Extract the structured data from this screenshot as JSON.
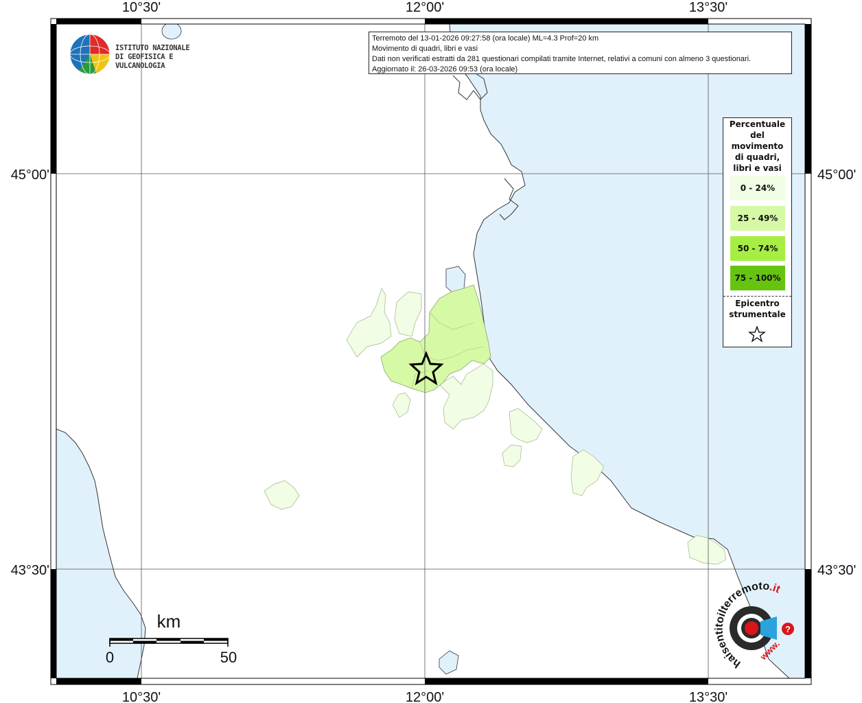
{
  "info": {
    "line1": "Terremoto del 13-01-2026 09:27:58 (ora locale) ML=4.3 Prof=20 km",
    "line2": "Movimento di quadri, libri e vasi",
    "line3": "Dati non verificati estratti da 281 questionari compilati tramite Internet, relativi a comuni con almeno 3 questionari.",
    "line4": "Aggiornato il: 26-03-2026 09:53 (ora locale)"
  },
  "logo": {
    "line1": "ISTITUTO NAZIONALE",
    "line2": "DI GEOFISICA E VULCANOLOGIA"
  },
  "axes": {
    "lon_labels": [
      "10°30'",
      "12°00'",
      "13°30'"
    ],
    "lat_labels": [
      "45°00'",
      "43°30'"
    ]
  },
  "scale_bar": {
    "unit": "km",
    "min_label": "0",
    "max_label": "50"
  },
  "legend": {
    "title_lines": [
      "Percentuale",
      "del",
      "movimento",
      "di quadri,",
      "libri e vasi"
    ],
    "items": [
      {
        "label": "0 - 24%",
        "color": "#f1fde4"
      },
      {
        "label": "25 - 49%",
        "color": "#d6f9a6"
      },
      {
        "label": "50 - 74%",
        "color": "#a7ee44"
      },
      {
        "label": "75 - 100%",
        "color": "#66c411"
      }
    ],
    "epicenter_lines": [
      "Epicentro",
      "strumentale"
    ]
  },
  "badge": {
    "text_main": "haisentitoilterremoto",
    "text_tld": ".it",
    "text_www": "www.",
    "text_q": "?"
  },
  "colors": {
    "sea": "#e1f1fc",
    "land": "#ffffff",
    "class1": "#f1fde4",
    "class2": "#d6f9a6",
    "frame": "#000000",
    "accent_red": "#d9151b"
  }
}
